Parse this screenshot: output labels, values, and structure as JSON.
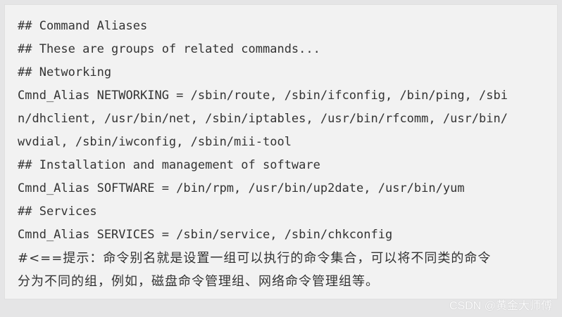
{
  "code_block": {
    "lines": [
      "## Command Aliases",
      "## These are groups of related commands...",
      "## Networking",
      "Cmnd_Alias NETWORKING = /sbin/route, /sbin/ifconfig, /bin/ping, /sbi",
      "n/dhclient, /usr/bin/net, /sbin/iptables, /usr/bin/rfcomm, /usr/bin/",
      "wvdial, /sbin/iwconfig, /sbin/mii-tool",
      "## Installation and management of software",
      "Cmnd_Alias SOFTWARE = /bin/rpm, /usr/bin/up2date, /usr/bin/yum",
      "## Services",
      "Cmnd_Alias SERVICES = /sbin/service, /sbin/chkconfig",
      "#<==提示：命令别名就是设置一组可以执行的命令集合，可以将不同类的命令",
      "分为不同的组，例如，磁盘命令管理组、网络命令管理组等。"
    ]
  },
  "watermark": {
    "text": "CSDN @黄金大师傅"
  },
  "colors": {
    "background": "#e5e5e6",
    "panel": "#f2f2f2",
    "text": "#333333"
  }
}
